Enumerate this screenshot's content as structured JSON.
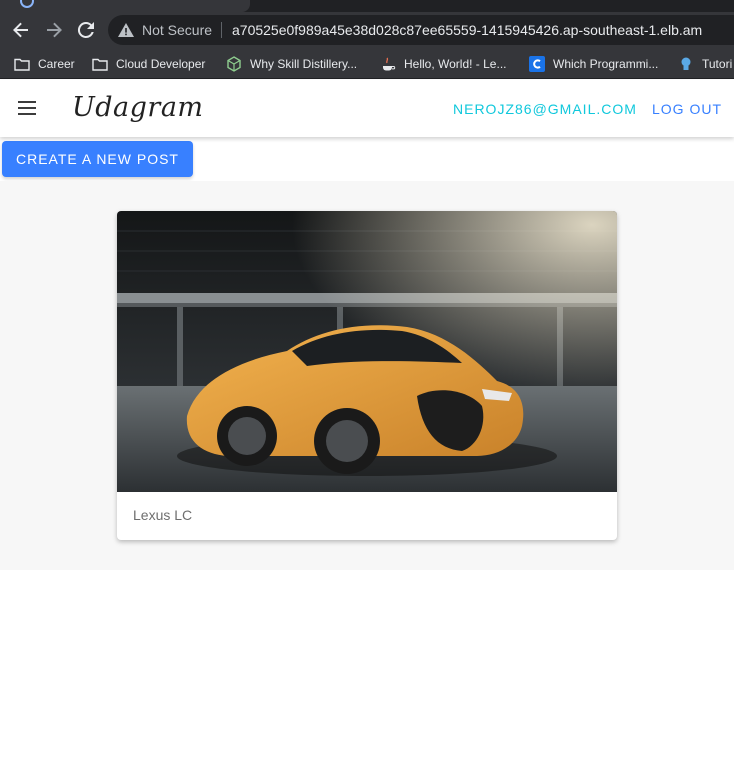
{
  "browser": {
    "security_label": "Not Secure",
    "url": "a70525e0f989a45e38d028c87ee65559-1415945426.ap-southeast-1.elb.am",
    "bookmarks": [
      {
        "label": "Career",
        "icon": "folder-icon"
      },
      {
        "label": "Cloud Developer",
        "icon": "folder-icon"
      },
      {
        "label": "Why Skill Distillery...",
        "icon": "cube-icon"
      },
      {
        "label": "Hello, World! - Le...",
        "icon": "java-icon"
      },
      {
        "label": "Which Programmi...",
        "icon": "c-logo-icon"
      },
      {
        "label": "Tutori",
        "icon": "tutorial-icon"
      }
    ]
  },
  "app": {
    "logo": "Udagram",
    "user_email": "NEROJZ86@GMAIL.COM",
    "logout_label": "LOG OUT",
    "create_post_label": "CREATE A NEW POST",
    "accent_color": "#3880ff",
    "email_color": "#10c8dc"
  },
  "feed": {
    "posts": [
      {
        "caption": "Lexus LC",
        "image": "orange-lexus-lc-photo"
      }
    ]
  }
}
